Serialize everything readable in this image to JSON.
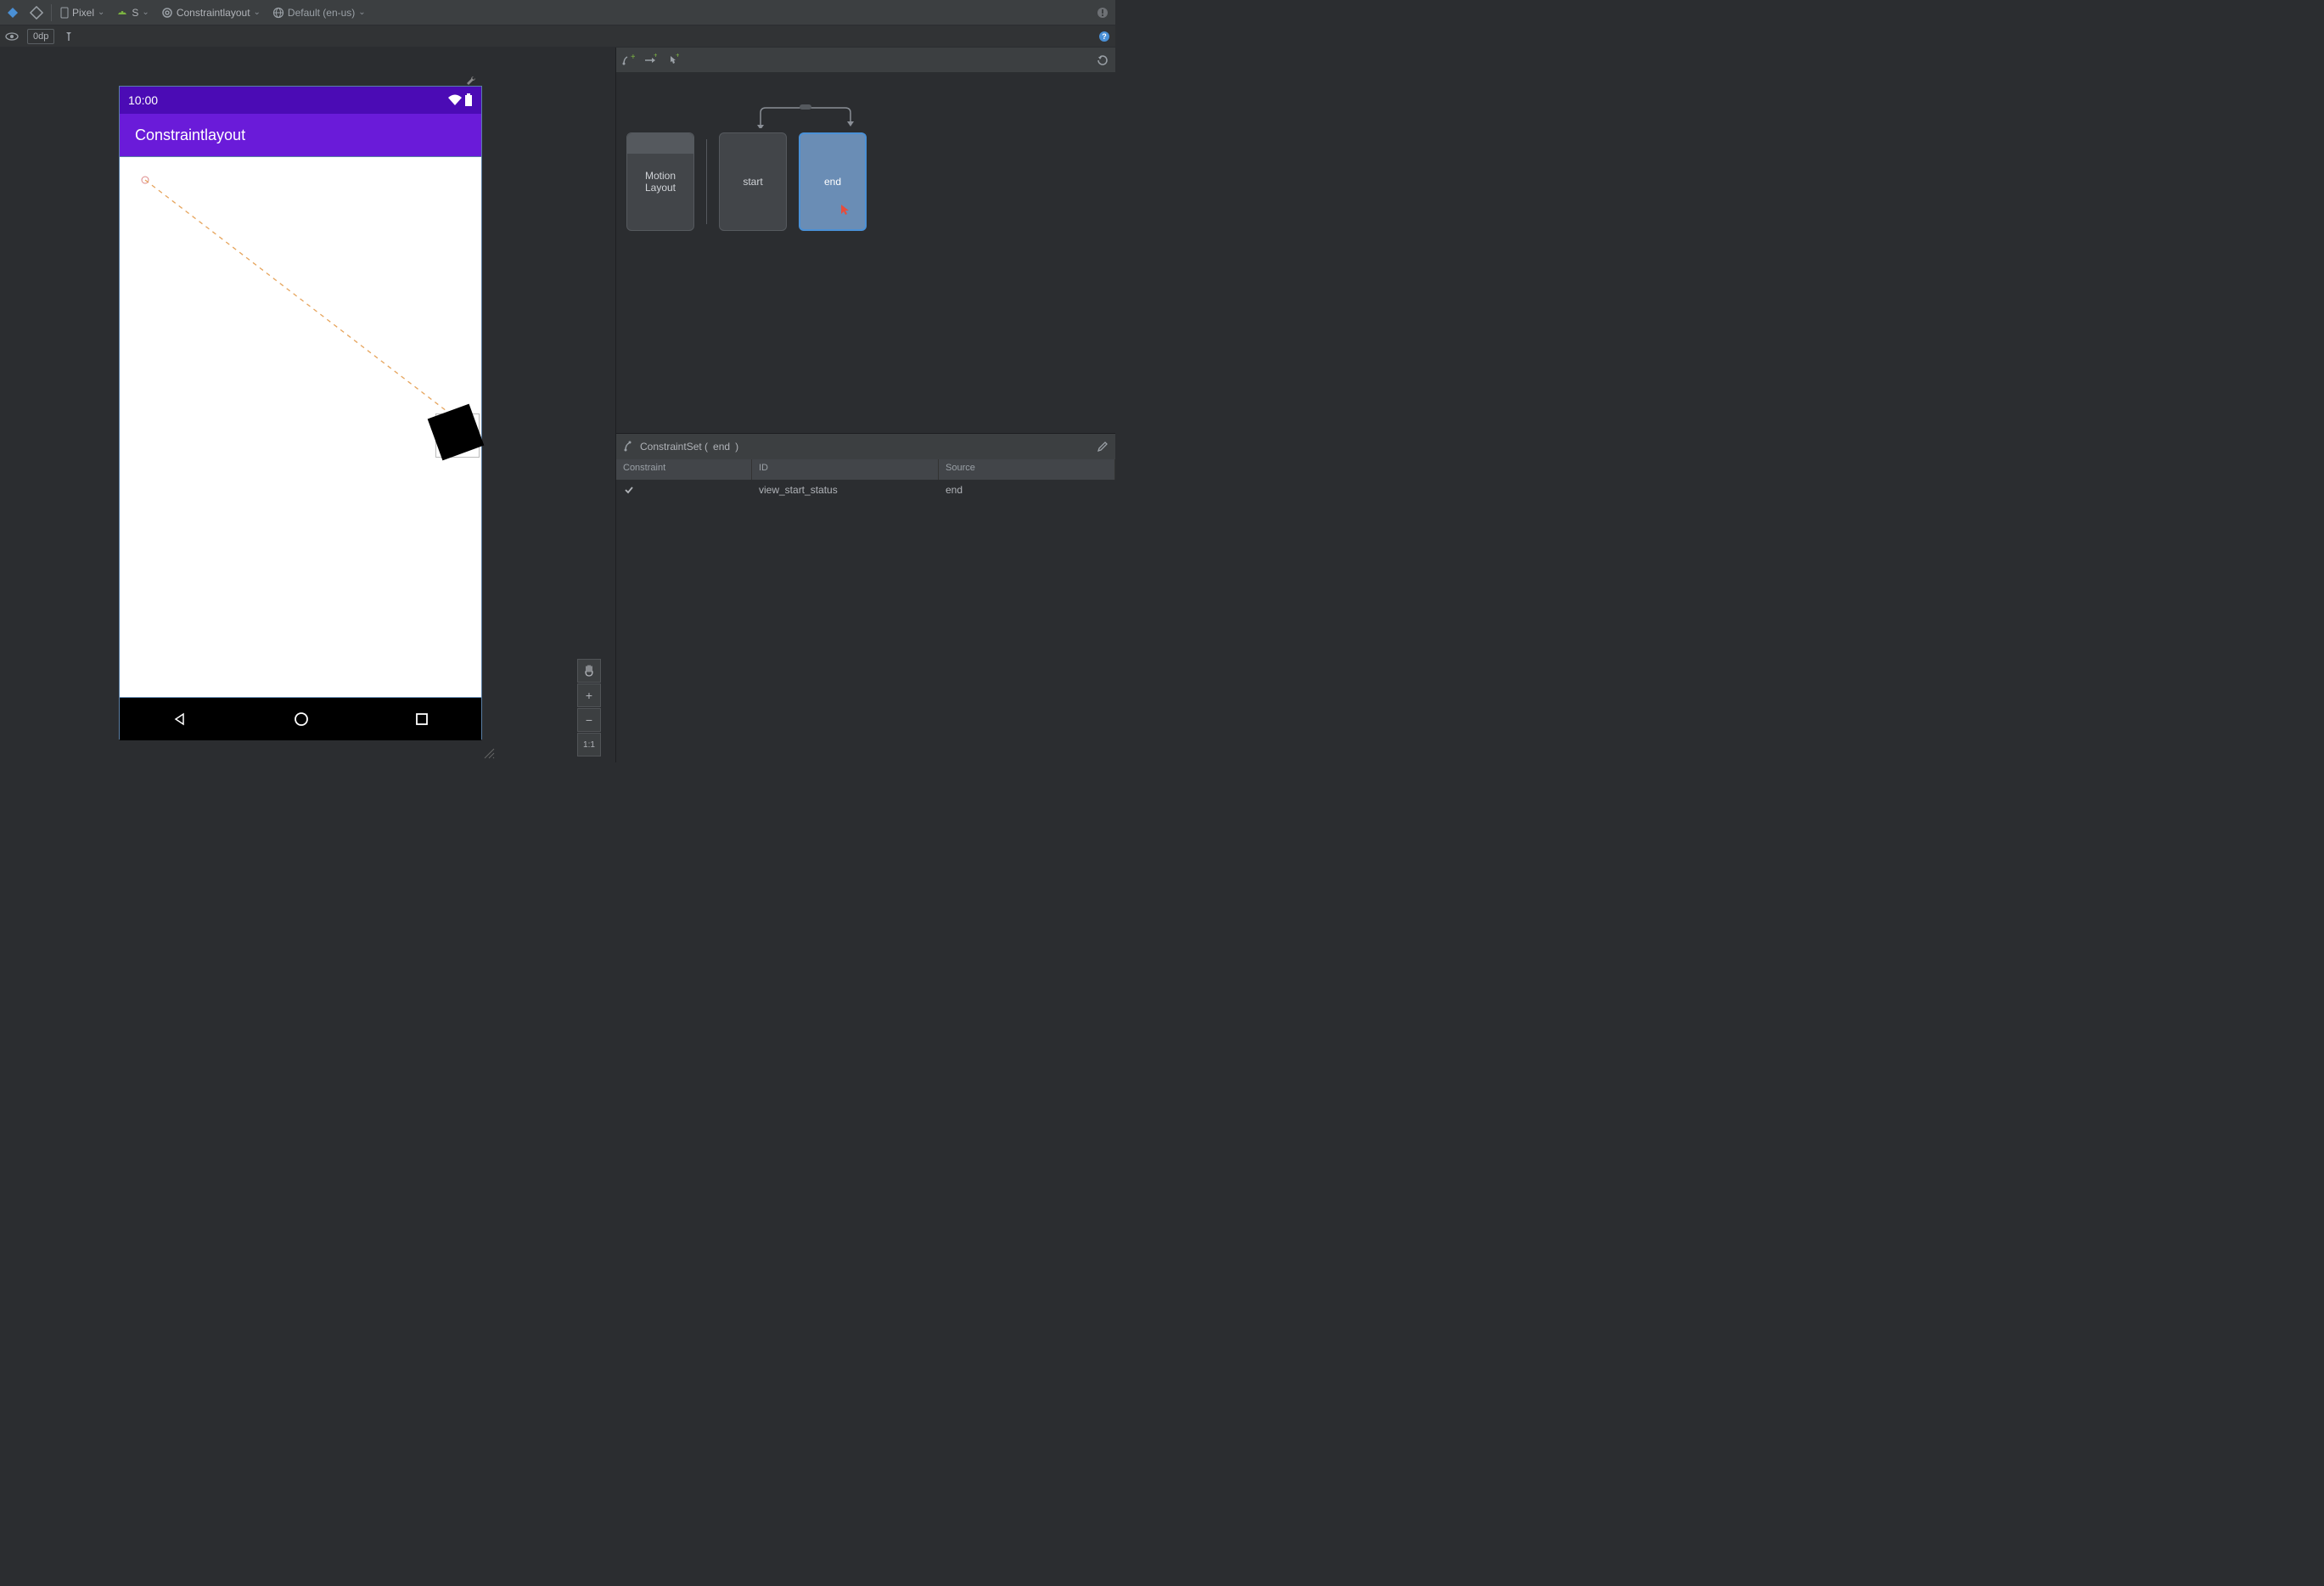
{
  "toolbar": {
    "device": "Pixel",
    "api": "S",
    "layout": "Constraintlayout",
    "locale": "Default (en-us)"
  },
  "toolbar2": {
    "margin": "0dp"
  },
  "phone": {
    "time": "10:00",
    "app_title": "Constraintlayout"
  },
  "zoom": {
    "onebyone": "1:1"
  },
  "motion": {
    "card_motionlayout_l1": "Motion",
    "card_motionlayout_l2": "Layout",
    "card_start": "start",
    "card_end": "end"
  },
  "cs": {
    "title_prefix": "ConstraintSet (",
    "title_name": "end",
    "title_suffix": ")",
    "col_constraint": "Constraint",
    "col_id": "ID",
    "col_source": "Source",
    "row": {
      "id": "view_start_status",
      "source": "end"
    }
  }
}
